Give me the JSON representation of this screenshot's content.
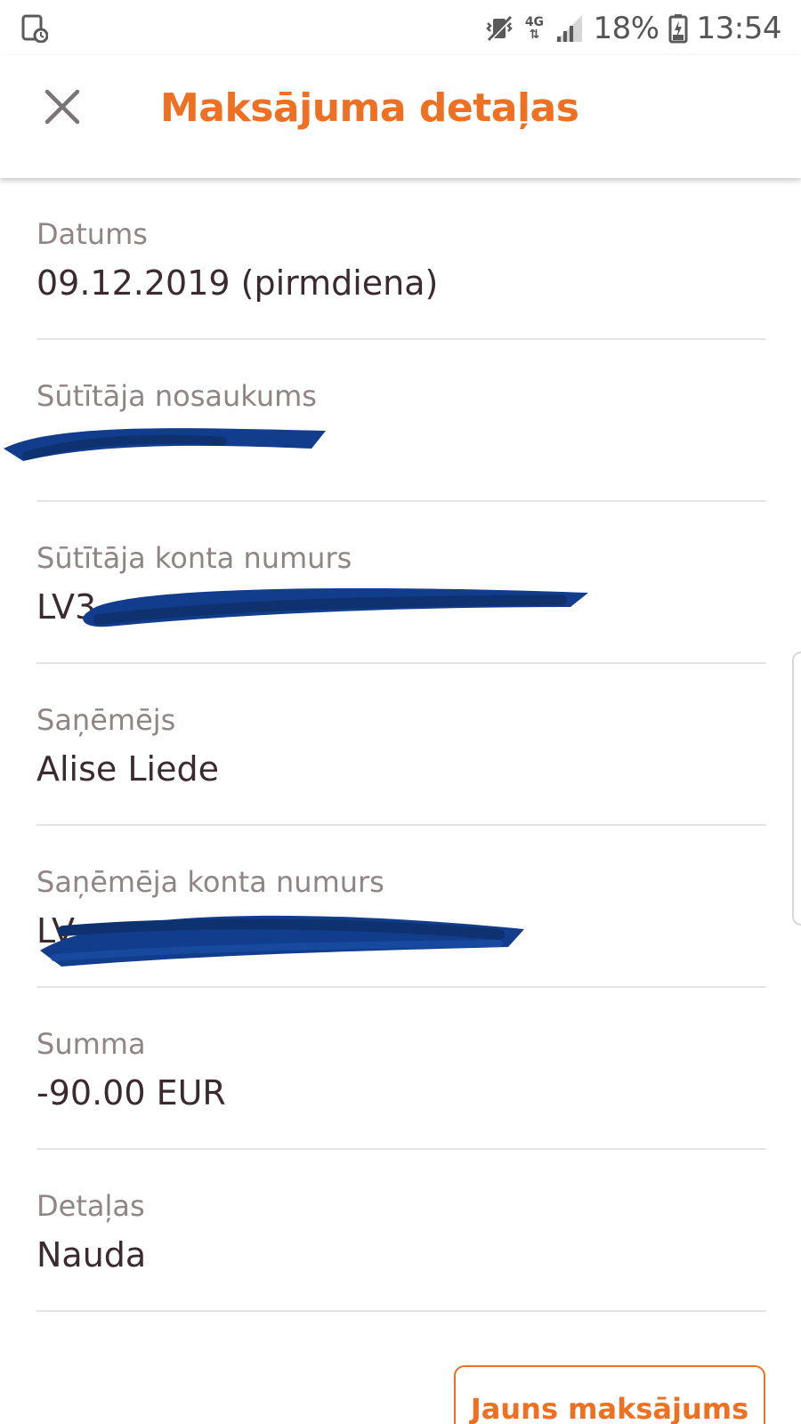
{
  "status_bar": {
    "icons": [
      "screenshot-sd-icon",
      "vibrate-mute-icon",
      "network-4g-icon",
      "signal-icon",
      "battery-charging-icon"
    ],
    "network_type": "4G",
    "battery": "18%",
    "time": "13:54"
  },
  "header": {
    "close_icon": "close-icon",
    "title": "Maksājuma detaļas"
  },
  "details": [
    {
      "label": "Datums",
      "value": "09.12.2019 (pirmdiena)",
      "redacted": false
    },
    {
      "label": "Sūtītāja nosaukums",
      "value": "",
      "redacted": true
    },
    {
      "label": "Sūtītāja konta numurs",
      "value": "LV3",
      "redacted": true
    },
    {
      "label": "Saņēmējs",
      "value": "Alise Liede",
      "redacted": false
    },
    {
      "label": "Saņēmēja konta numurs",
      "value": "LV",
      "redacted": true
    },
    {
      "label": "Summa",
      "value": "-90.00 EUR",
      "redacted": false
    },
    {
      "label": "Detaļas",
      "value": "Nauda",
      "redacted": false
    }
  ],
  "actions": {
    "new_payment_label": "Jauns maksājums"
  },
  "colors": {
    "accent": "#ee7023",
    "label_text": "#8f8585",
    "value_text": "#3b2a2f",
    "divider": "#e6e3e3",
    "redaction": "#123d8c"
  }
}
